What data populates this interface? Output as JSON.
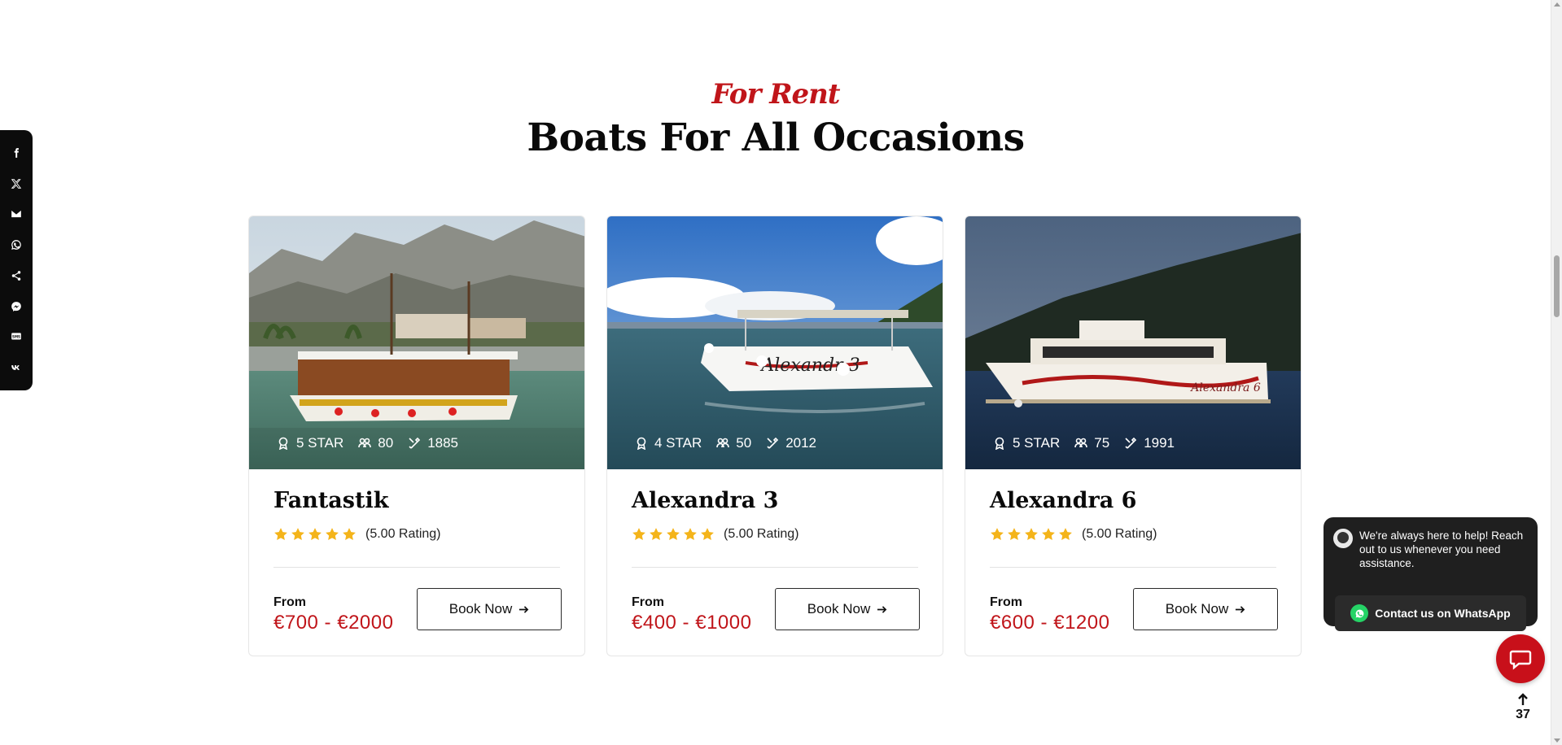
{
  "share_bar": {
    "items": [
      {
        "icon": "facebook-icon"
      },
      {
        "icon": "x-twitter-icon"
      },
      {
        "icon": "email-icon"
      },
      {
        "icon": "whatsapp-icon"
      },
      {
        "icon": "share-icon"
      },
      {
        "icon": "messenger-icon"
      },
      {
        "icon": "sms-icon"
      },
      {
        "icon": "vk-icon"
      }
    ]
  },
  "section": {
    "kicker": "For Rent",
    "title": "Boats For All Occasions"
  },
  "boats": [
    {
      "name": "Fantastik",
      "stars": "5 STAR",
      "capacity": "80",
      "year": "1885",
      "rating_text": "(5.00 Rating)",
      "rating_value": 5,
      "from_label": "From",
      "price": "€700 - €2000",
      "book_label": "Book Now"
    },
    {
      "name": "Alexandra 3",
      "stars": "4 STAR",
      "capacity": "50",
      "year": "2012",
      "rating_text": "(5.00 Rating)",
      "rating_value": 5,
      "from_label": "From",
      "price": "€400 - €1000",
      "book_label": "Book Now"
    },
    {
      "name": "Alexandra 6",
      "stars": "5 STAR",
      "capacity": "75",
      "year": "1991",
      "rating_text": "(5.00 Rating)",
      "rating_value": 5,
      "from_label": "From",
      "price": "€600 - €1200",
      "book_label": "Book Now"
    }
  ],
  "whatsapp": {
    "message": "We're always here to help! Reach out to us whenever you need assistance.",
    "cta": "Contact us on WhatsApp"
  },
  "scroll_top": {
    "count": "37"
  },
  "colors": {
    "accent": "#c0151a",
    "star": "#f4b41a",
    "share_bar": "#0c0c0c",
    "help_button": "#c8101a",
    "whatsapp_green": "#25d366"
  }
}
